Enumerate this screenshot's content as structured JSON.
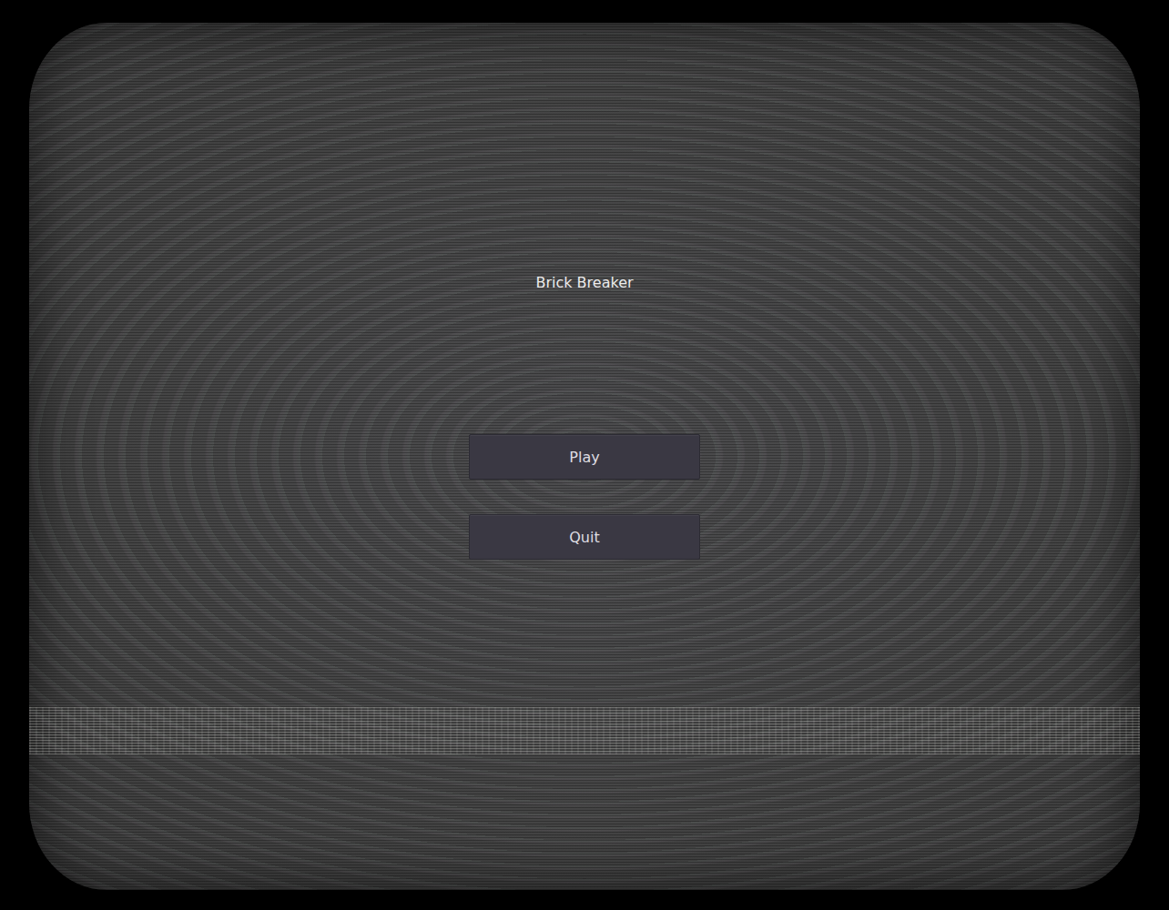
{
  "title": "Brick Breaker",
  "buttons": [
    {
      "label": "Play"
    },
    {
      "label": "Quit"
    }
  ]
}
